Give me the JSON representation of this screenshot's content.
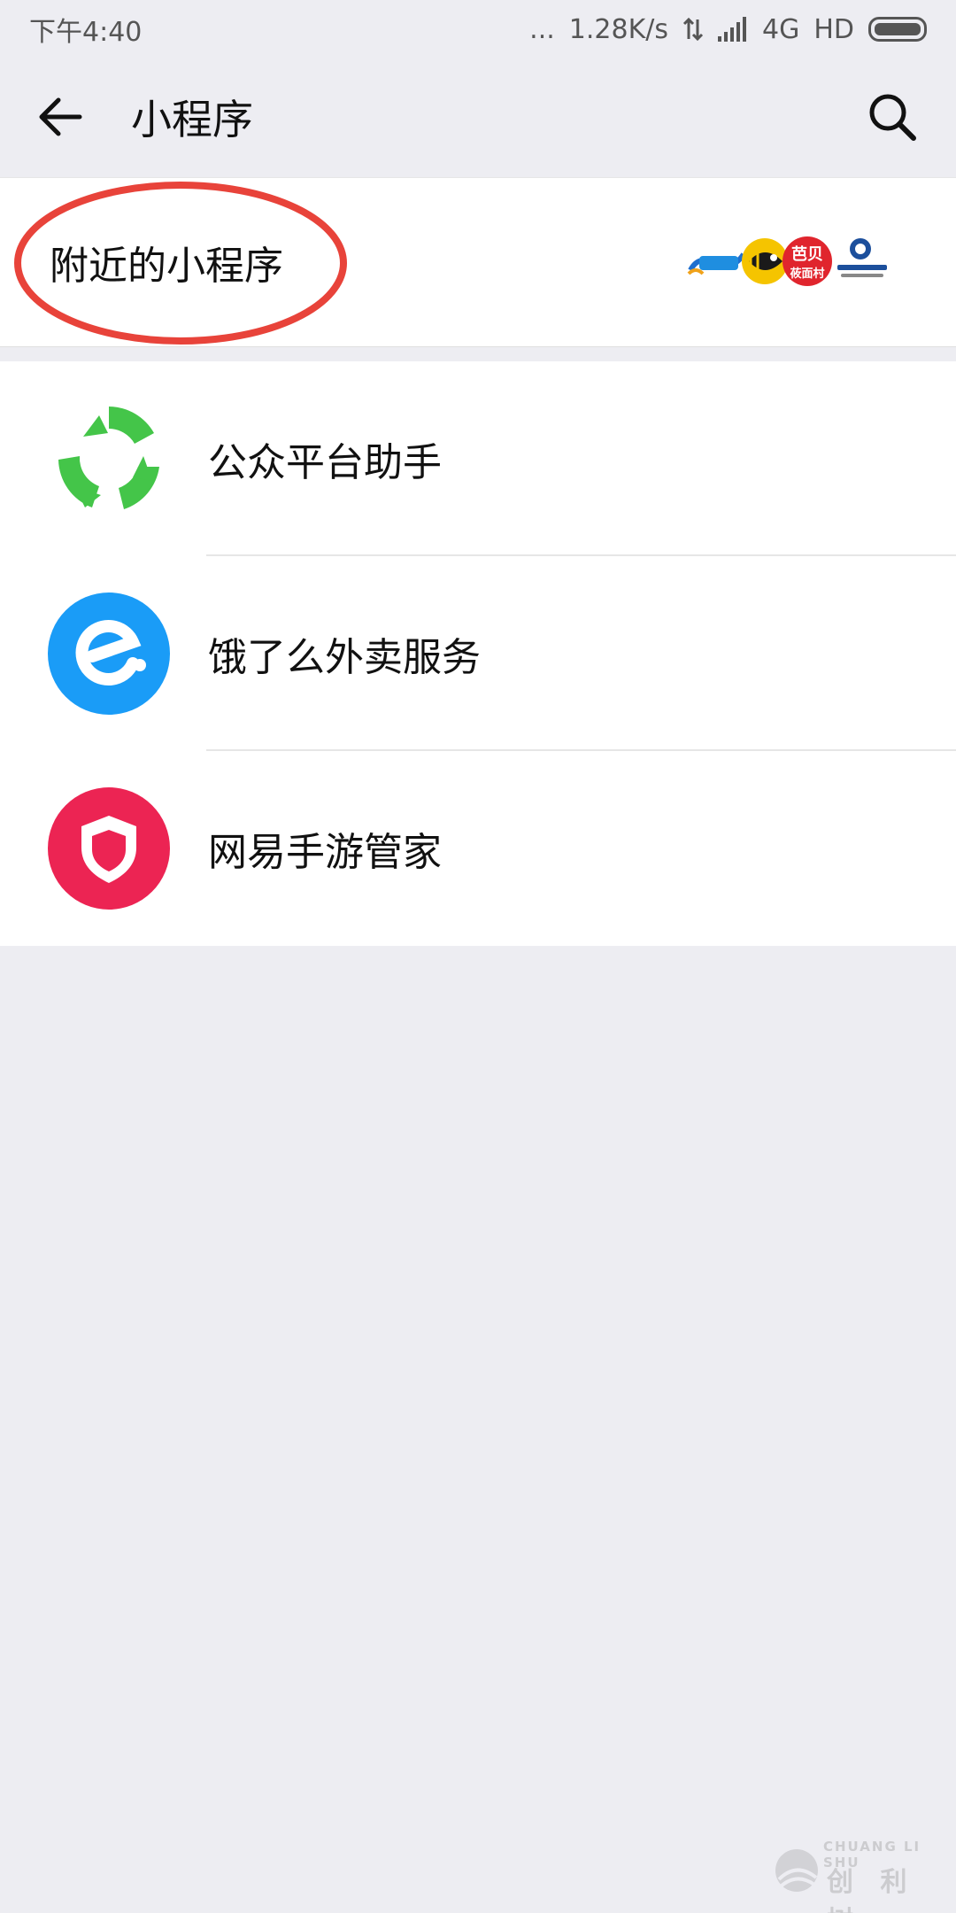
{
  "status_bar": {
    "time": "下午4:40",
    "dots": "...",
    "speed": "1.28K/s",
    "network": "4G",
    "hd": "HD"
  },
  "header": {
    "title": "小程序",
    "back_icon": "back-arrow-icon",
    "search_icon": "search-icon"
  },
  "nearby": {
    "label": "附近的小程序",
    "logo_texts": [
      "芭贝",
      "莜面村"
    ],
    "annotation_color": "#e8433a"
  },
  "list": {
    "items": [
      {
        "label": "公众平台助手",
        "icon": "wechat-mp-assistant-icon",
        "color": "#44c549"
      },
      {
        "label": "饿了么外卖服务",
        "icon": "eleme-icon",
        "color": "#1a9cf7"
      },
      {
        "label": "网易手游管家",
        "icon": "netease-shield-icon",
        "color": "#ec2453"
      }
    ]
  },
  "watermark": {
    "line1": "CHUANG LI SHU",
    "line2": "创 利 树"
  }
}
